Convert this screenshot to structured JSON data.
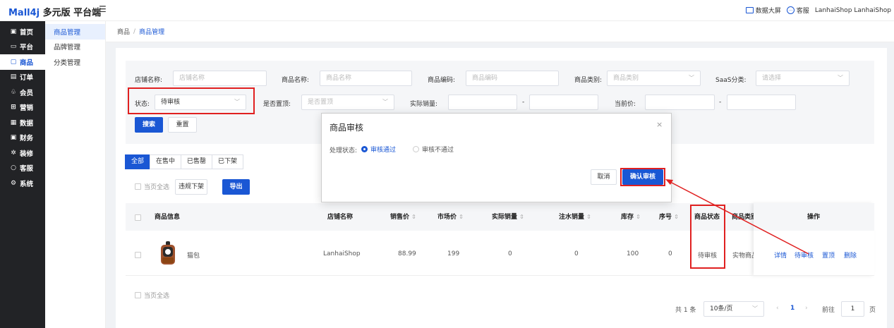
{
  "app": {
    "logo": "Mall4j",
    "edition": "多元版 平台端",
    "menu_toggle_icon": "hamburger-icon"
  },
  "header_right": {
    "dashboard": "数据大屏",
    "service": "客服",
    "shop": "LanhaiShop",
    "user": "LanhaiShop"
  },
  "sidebar": {
    "items": [
      {
        "icon": "home-icon",
        "glyph": "▣",
        "label": "首页"
      },
      {
        "icon": "platform-icon",
        "glyph": "▭",
        "label": "平台"
      },
      {
        "icon": "goods-icon",
        "glyph": "▢",
        "label": "商品"
      },
      {
        "icon": "order-icon",
        "glyph": "▤",
        "label": "订单"
      },
      {
        "icon": "member-icon",
        "glyph": "♧",
        "label": "会员"
      },
      {
        "icon": "marketing-icon",
        "glyph": "⊞",
        "label": "营销"
      },
      {
        "icon": "data-icon",
        "glyph": "▦",
        "label": "数据"
      },
      {
        "icon": "finance-icon",
        "glyph": "▣",
        "label": "财务"
      },
      {
        "icon": "decorate-icon",
        "glyph": "✲",
        "label": "装修"
      },
      {
        "icon": "service-icon",
        "glyph": "○",
        "label": "客服"
      },
      {
        "icon": "system-icon",
        "glyph": "⚙",
        "label": "系统"
      }
    ]
  },
  "subnav": {
    "items": [
      "商品管理",
      "品牌管理",
      "分类管理"
    ]
  },
  "breadcrumb": {
    "root": "商品",
    "sep": "/",
    "current": "商品管理"
  },
  "filter": {
    "shop_label": "店铺名称:",
    "shop_ph": "店铺名称",
    "name_label": "商品名称:",
    "name_ph": "商品名称",
    "code_label": "商品编码:",
    "code_ph": "商品编码",
    "cat_label": "商品类别:",
    "cat_ph": "商品类别",
    "saas_label": "SaaS分类:",
    "saas_ph": "请选择",
    "status_label": "状态:",
    "status_value": "待审核",
    "top_label": "是否置顶:",
    "top_ph": "是否置顶",
    "sales_label": "实际销量:",
    "dash": "-",
    "price_label": "当前价:",
    "search_btn": "搜索",
    "reset_btn": "重置"
  },
  "tabs": [
    "全部",
    "在售中",
    "已售罄",
    "已下架"
  ],
  "actions": {
    "select_page": "当页全选",
    "offshelf": "违规下架",
    "export": "导出"
  },
  "table": {
    "headers": {
      "info": "商品信息",
      "shop": "店铺名称",
      "sale_price": "销售价",
      "market_price": "市场价",
      "actual_sales": "实际销量",
      "fake_sales": "注水销量",
      "stock": "库存",
      "seq": "序号",
      "status": "商品状态",
      "category": "商品类别",
      "ops": "操作"
    },
    "row": {
      "name": "猫包",
      "shop": "LanhaiShop",
      "sale_price": "88.99",
      "market_price": "199",
      "actual_sales": "0",
      "fake_sales": "0",
      "stock": "100",
      "seq": "0",
      "status": "待审核",
      "category": "实物商品",
      "op_detail": "详情",
      "op_audit": "待审核",
      "op_top": "置顶",
      "op_delete": "删除"
    }
  },
  "footer": {
    "select_page": "当页全选"
  },
  "pagination": {
    "total": "共 1 条",
    "page_size": "10条/页",
    "prev": "‹",
    "current": "1",
    "next": "›",
    "goto": "前往",
    "goto_value": "1",
    "page_unit": "页"
  },
  "dialog": {
    "title": "商品审核",
    "close": "×",
    "status_label": "处理状态:",
    "pass": "审核通过",
    "reject": "审核不通过",
    "cancel": "取消",
    "confirm": "确认审核"
  },
  "colors": {
    "accent": "#1a57d4",
    "annotation": "#e02020",
    "sidebar_bg": "#222326"
  }
}
